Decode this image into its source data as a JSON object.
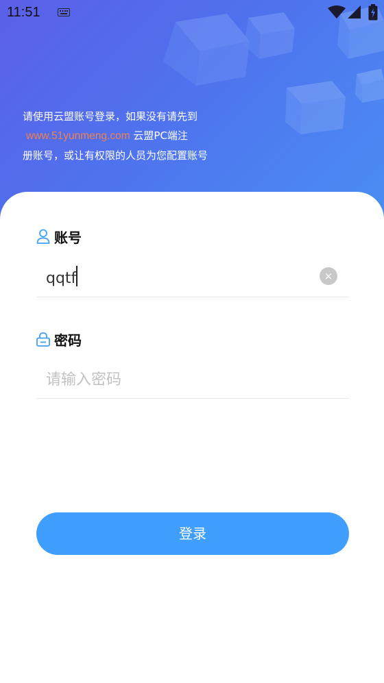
{
  "status_bar": {
    "time": "11:51",
    "icons": [
      "keyboard-icon",
      "wifi-icon",
      "signal-icon",
      "battery-icon"
    ]
  },
  "intro": {
    "line1": "请使用云盟账号登录，如果没有请先到",
    "link": "www.51yunmeng.com",
    "line2_suffix": " 云盟PC端注",
    "line3": "册账号，或让有权限的人员为您配置账号"
  },
  "form": {
    "account": {
      "label": "账号",
      "value": "qqtf",
      "icon": "user-icon"
    },
    "password": {
      "label": "密码",
      "value": "",
      "placeholder": "请输入密码",
      "icon": "lock-icon"
    },
    "clear_symbol": "×",
    "submit_label": "登录"
  },
  "colors": {
    "primary": "#409eff",
    "link": "#f0824b",
    "hero_start": "#5b5fe8",
    "hero_end": "#4a8ff3"
  }
}
